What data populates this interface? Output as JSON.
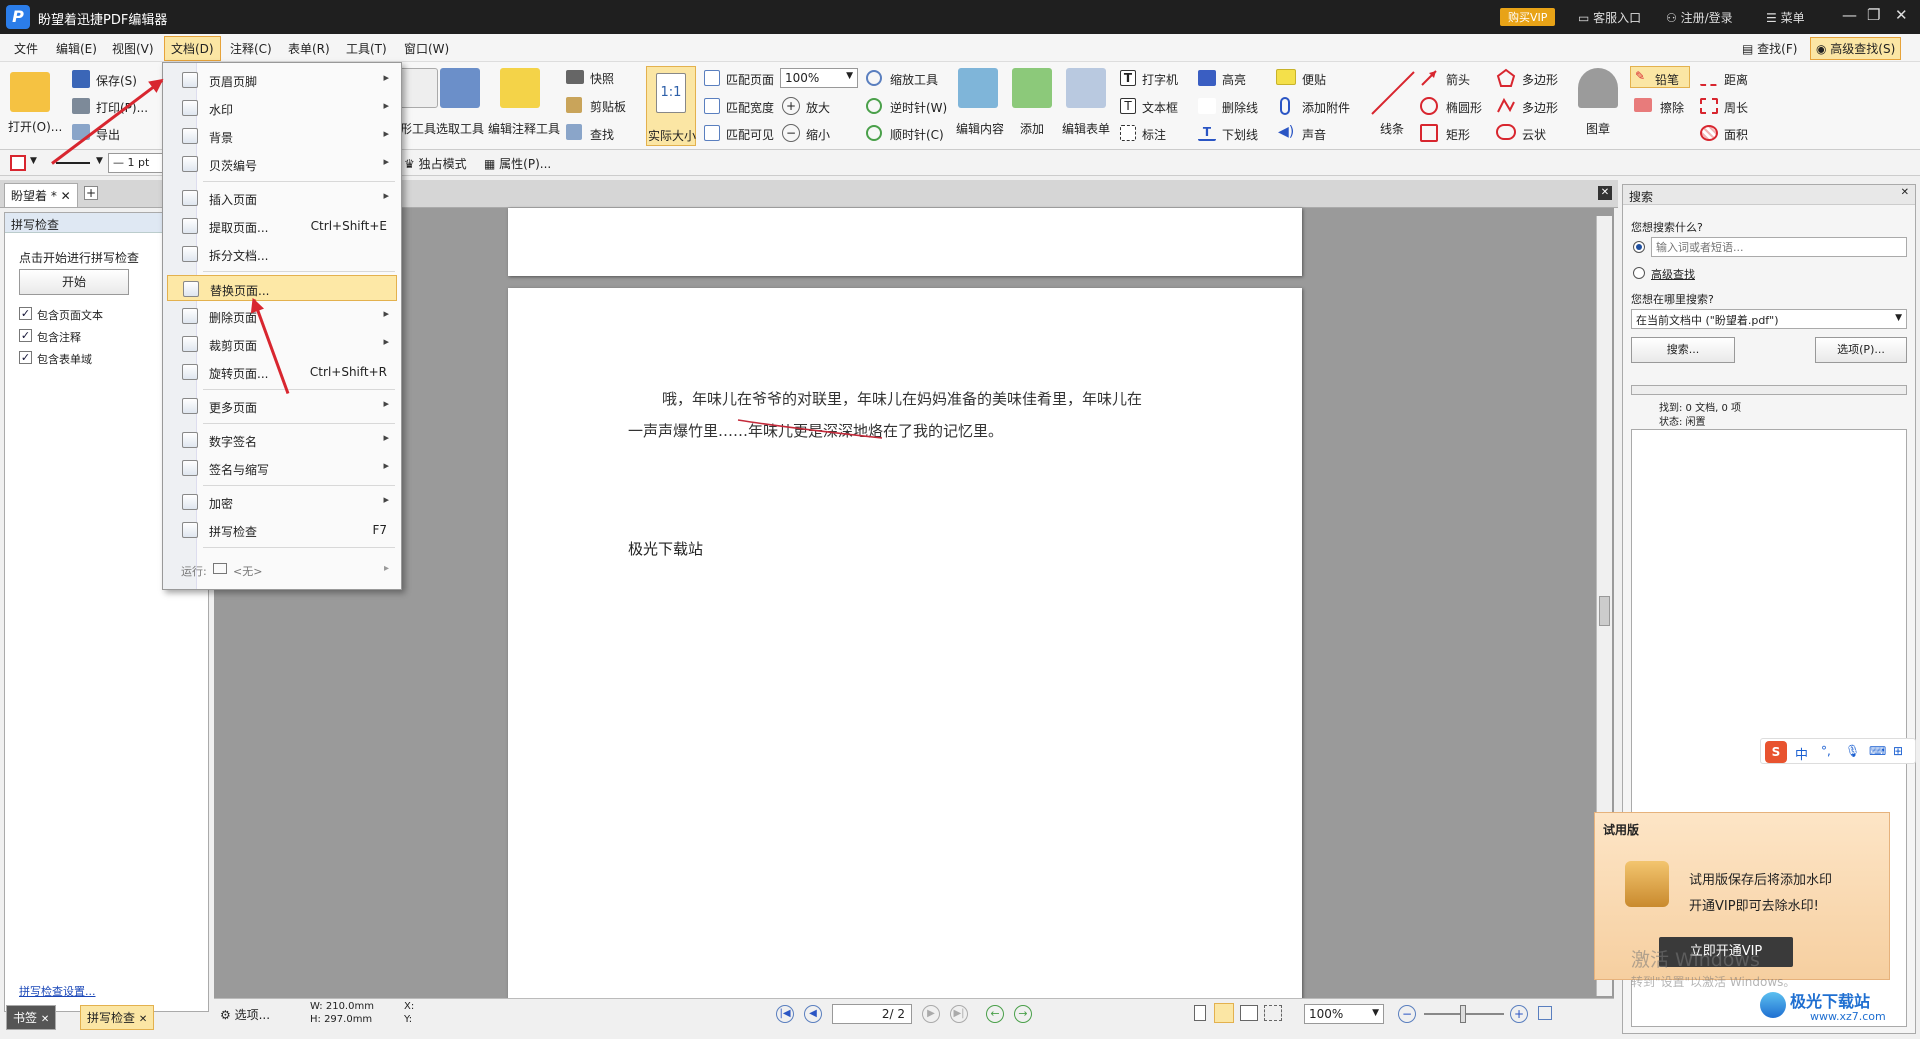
{
  "app": {
    "title": "盼望着迅捷PDF编辑器",
    "vip_label": "购买VIP",
    "service": "客服入口",
    "login": "注册/登录",
    "menu": "菜单"
  },
  "menubar": [
    "文件",
    "编辑(E)",
    "视图(V)",
    "文档(D)",
    "注释(C)",
    "表单(R)",
    "工具(T)",
    "窗口(W)"
  ],
  "ribbon": {
    "open": "打开(O)...",
    "save": "保存(S)",
    "print": "打印(P)...",
    "export": "导出",
    "hand_tool": "形工具",
    "select_tool": "选取工具",
    "edit_annot_tool": "编辑注释工具",
    "snapshot": "快照",
    "clipboard": "剪贴板",
    "find": "查找",
    "actual_size": "实际大小",
    "fit_page": "匹配页面",
    "fit_width": "匹配宽度",
    "fit_visible": "匹配可见",
    "zoom_value": "100%",
    "zoom_tool": "缩放工具",
    "zoom_in": "放大",
    "zoom_out": "缩小",
    "rotate_ccw": "逆时针(W)",
    "rotate_cw": "顺时针(C)",
    "edit_content": "编辑内容",
    "add": "添加",
    "edit_form": "编辑表单",
    "typewriter": "打字机",
    "textbox": "文本框",
    "callout": "标注",
    "highlight": "高亮",
    "strikeout": "删除线",
    "underline": "下划线",
    "note": "便贴",
    "attach": "添加附件",
    "sound": "声音",
    "line": "线条",
    "arrow": "箭头",
    "ellipse": "椭圆形",
    "rect": "矩形",
    "polygon": "多边形",
    "polyline": "多边形",
    "cloud": "云状",
    "stamp": "图章",
    "pencil": "铅笔",
    "eraser": "擦除",
    "distance": "距离",
    "perimeter": "周长",
    "area": "面积",
    "search": "查找(F)",
    "adv_search": "高级查找(S)"
  },
  "toolbar2": {
    "line_width": "1 pt",
    "solo_mode": "独占模式",
    "properties": "属性(P)..."
  },
  "doc_tab": "盼望着 *",
  "left_panel": {
    "header": "拼写检查",
    "hint": "点击开始进行拼写检查",
    "start": "开始",
    "options": [
      "包含页面文本",
      "包含注释",
      "包含表单域"
    ],
    "settings_link": "拼写检查设置...",
    "tabs": [
      "书签",
      "拼写检查"
    ]
  },
  "dropdown": {
    "items": [
      {
        "label": "页眉页脚",
        "shortcut": "",
        "sub": true
      },
      {
        "label": "水印",
        "shortcut": "",
        "sub": true
      },
      {
        "label": "背景",
        "shortcut": "",
        "sub": true
      },
      {
        "label": "贝茨编号",
        "shortcut": "",
        "sub": true
      },
      {
        "label": "插入页面",
        "shortcut": "",
        "sub": true
      },
      {
        "label": "提取页面...",
        "shortcut": "Ctrl+Shift+E",
        "sub": false
      },
      {
        "label": "拆分文档...",
        "shortcut": "",
        "sub": false
      },
      {
        "label": "替换页面...",
        "shortcut": "",
        "sub": false
      },
      {
        "label": "删除页面",
        "shortcut": "",
        "sub": true
      },
      {
        "label": "裁剪页面",
        "shortcut": "",
        "sub": true
      },
      {
        "label": "旋转页面...",
        "shortcut": "Ctrl+Shift+R",
        "sub": false
      },
      {
        "label": "更多页面",
        "shortcut": "",
        "sub": true
      },
      {
        "label": "数字签名",
        "shortcut": "",
        "sub": true
      },
      {
        "label": "签名与缩写",
        "shortcut": "",
        "sub": true
      },
      {
        "label": "加密",
        "shortcut": "",
        "sub": true
      },
      {
        "label": "拼写检查",
        "shortcut": "F7",
        "sub": false
      }
    ],
    "run_label": "运行:",
    "run_value": "<无>"
  },
  "document": {
    "line1": "哦，年味儿在爷爷的对联里，年味儿在妈妈准备的美味佳肴里，年味儿在",
    "line2": "一声声爆竹里……年味儿更是深深地烙在了我的记忆里。",
    "site": "极光下载站"
  },
  "status": {
    "options": "选项...",
    "width": "W: 210.0mm",
    "height": "H: 297.0mm",
    "x": "X:",
    "y": "Y:",
    "page": "2",
    "total": "/ 2",
    "zoom": "100%"
  },
  "right_panel": {
    "title": "搜索",
    "q1": "您想搜索什么?",
    "placeholder": "输入词或者短语...",
    "adv": "高级查找",
    "q2": "您想在哪里搜索?",
    "scope": "在当前文档中 (\"盼望着.pdf\")",
    "search_btn": "搜索...",
    "options_btn": "选项(P)...",
    "found": "找到: 0 文档, 0 项",
    "state": "状态: 闲置"
  },
  "ime": [
    "中",
    "°,",
    "🎤",
    "⌨",
    "⊞"
  ],
  "trial": {
    "title": "试用版",
    "line1": "试用版保存后将添加水印",
    "line2": "开通VIP即可去除水印!",
    "button": "立即开通VIP",
    "activate": "激活 Windows",
    "activate_sub": "转到\"设置\"以激活 Windows。"
  },
  "watermark": {
    "text": "极光下载站",
    "url": "www.xz7.com"
  },
  "colors": {
    "accent": "#e6a33a",
    "highlight": "#fde8a6",
    "arrow": "#d8262f"
  }
}
